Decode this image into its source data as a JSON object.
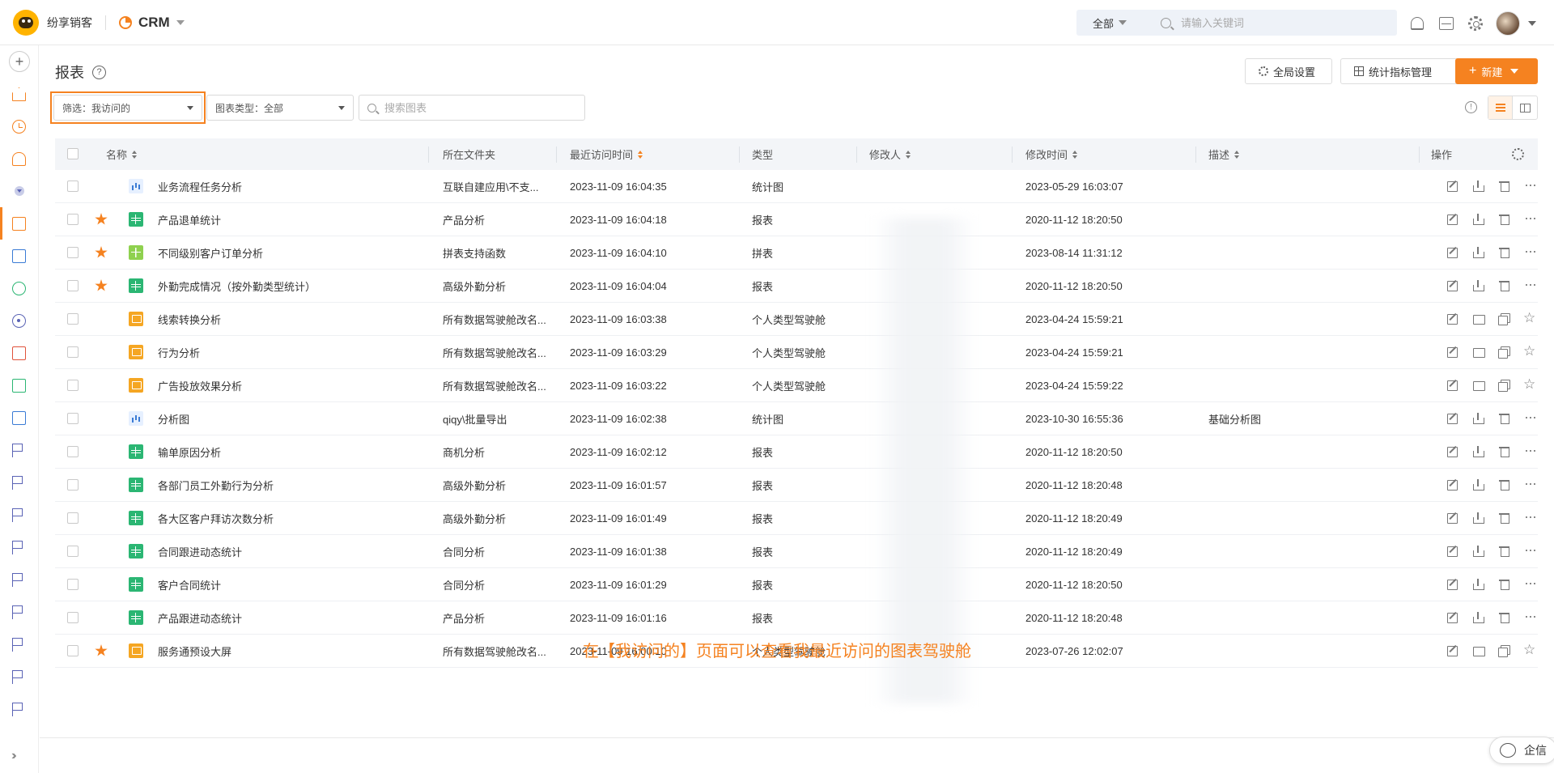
{
  "header": {
    "brand": "纷享销客",
    "app_name": "CRM",
    "search_scope": "全部",
    "search_placeholder": "请输入关键词"
  },
  "page": {
    "title": "报表",
    "buttons": {
      "global_settings": "全局设置",
      "metric_management": "统计指标管理",
      "new": "新建"
    },
    "filters": {
      "filter": "筛选：我访问的",
      "chart_type": "图表类型：全部",
      "search_placeholder": "搜索图表"
    }
  },
  "table": {
    "columns": [
      "名称",
      "所在文件夹",
      "最近访问时间",
      "类型",
      "修改人",
      "修改时间",
      "描述",
      "操作"
    ],
    "rows": [
      {
        "starred": false,
        "icon": "stat",
        "name": "业务流程任务分析",
        "folder": "互联自建应用\\不支...",
        "visited": "2023-11-09 16:04:35",
        "type": "统计图",
        "modified": "2023-05-29 16:03:07",
        "desc": "",
        "ops": "edit"
      },
      {
        "starred": true,
        "icon": "report",
        "name": "产品退单统计",
        "folder": "产品分析",
        "visited": "2023-11-09 16:04:18",
        "type": "报表",
        "modified": "2020-11-12 18:20:50",
        "desc": "",
        "ops": "edit"
      },
      {
        "starred": true,
        "icon": "concat",
        "name": "不同级别客户订单分析",
        "folder": "拼表支持函数",
        "visited": "2023-11-09 16:04:10",
        "type": "拼表",
        "modified": "2023-08-14 11:31:12",
        "desc": "",
        "ops": "edit"
      },
      {
        "starred": true,
        "icon": "report",
        "name": "外勤完成情况（按外勤类型统计）",
        "folder": "高级外勤分析",
        "visited": "2023-11-09 16:04:04",
        "type": "报表",
        "modified": "2020-11-12 18:20:50",
        "desc": "",
        "ops": "edit"
      },
      {
        "starred": false,
        "icon": "cockpit",
        "name": "线索转换分析",
        "folder": "所有数据驾驶舱改名...",
        "visited": "2023-11-09 16:03:38",
        "type": "个人类型驾驶舱",
        "modified": "2023-04-24 15:59:21",
        "desc": "",
        "ops": "cockpit"
      },
      {
        "starred": false,
        "icon": "cockpit",
        "name": "行为分析",
        "folder": "所有数据驾驶舱改名...",
        "visited": "2023-11-09 16:03:29",
        "type": "个人类型驾驶舱",
        "modified": "2023-04-24 15:59:21",
        "desc": "",
        "ops": "cockpit"
      },
      {
        "starred": false,
        "icon": "cockpit",
        "name": "广告投放效果分析",
        "folder": "所有数据驾驶舱改名...",
        "visited": "2023-11-09 16:03:22",
        "type": "个人类型驾驶舱",
        "modified": "2023-04-24 15:59:22",
        "desc": "",
        "ops": "cockpit"
      },
      {
        "starred": false,
        "icon": "stat",
        "name": "分析图",
        "folder": "qiqy\\批量导出",
        "visited": "2023-11-09 16:02:38",
        "type": "统计图",
        "modified": "2023-10-30 16:55:36",
        "desc": "基础分析图",
        "ops": "edit"
      },
      {
        "starred": false,
        "icon": "report",
        "name": "输单原因分析",
        "folder": "商机分析",
        "visited": "2023-11-09 16:02:12",
        "type": "报表",
        "modified": "2020-11-12 18:20:50",
        "desc": "",
        "ops": "edit"
      },
      {
        "starred": false,
        "icon": "report",
        "name": "各部门员工外勤行为分析",
        "folder": "高级外勤分析",
        "visited": "2023-11-09 16:01:57",
        "type": "报表",
        "modified": "2020-11-12 18:20:48",
        "desc": "",
        "ops": "edit"
      },
      {
        "starred": false,
        "icon": "report",
        "name": "各大区客户拜访次数分析",
        "folder": "高级外勤分析",
        "visited": "2023-11-09 16:01:49",
        "type": "报表",
        "modified": "2020-11-12 18:20:49",
        "desc": "",
        "ops": "edit"
      },
      {
        "starred": false,
        "icon": "report",
        "name": "合同跟进动态统计",
        "folder": "合同分析",
        "visited": "2023-11-09 16:01:38",
        "type": "报表",
        "modified": "2020-11-12 18:20:49",
        "desc": "",
        "ops": "edit"
      },
      {
        "starred": false,
        "icon": "report",
        "name": "客户合同统计",
        "folder": "合同分析",
        "visited": "2023-11-09 16:01:29",
        "type": "报表",
        "modified": "2020-11-12 18:20:50",
        "desc": "",
        "ops": "edit"
      },
      {
        "starred": false,
        "icon": "report",
        "name": "产品跟进动态统计",
        "folder": "产品分析",
        "visited": "2023-11-09 16:01:16",
        "type": "报表",
        "modified": "2020-11-12 18:20:48",
        "desc": "",
        "ops": "edit"
      },
      {
        "starred": true,
        "icon": "cockpit",
        "name": "服务通预设大屏",
        "folder": "所有数据驾驶舱改名...",
        "visited": "2023-11-09 16:00:10",
        "type": "个人类型驾驶舱",
        "modified": "2023-07-26 12:02:07",
        "desc": "",
        "ops": "cockpit"
      }
    ]
  },
  "caption": "在【我访问的】页面可以查看我最近访问的图表驾驶舱",
  "qixin_label": "企信",
  "colors": {
    "accent": "#f58220"
  }
}
